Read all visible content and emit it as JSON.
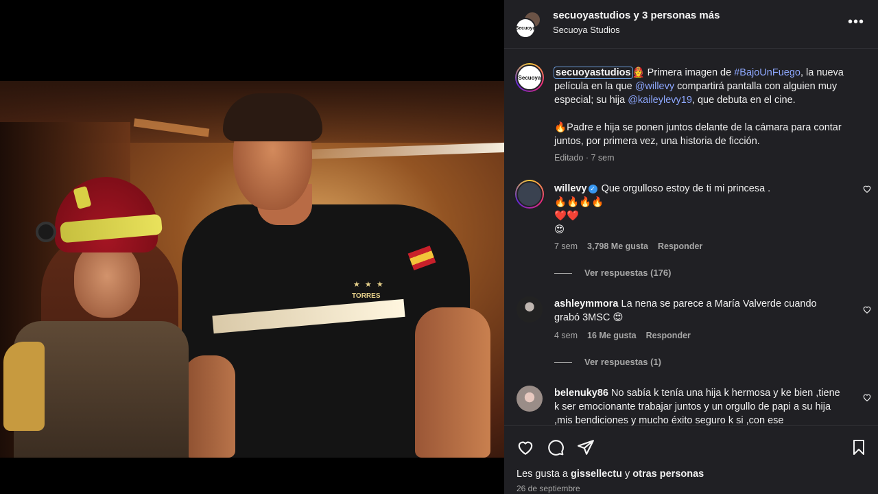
{
  "header": {
    "account": "secuoyastudios",
    "joined_text": " y 3 personas más",
    "subtitle": "Secuoya Studios",
    "avatar_text": "Secuoya",
    "more": "•••"
  },
  "photo": {
    "badge_name": "TORRES",
    "badge_stars": "★ ★ ★"
  },
  "caption": {
    "avatar_text": "Secuoya",
    "user": "secuoyastudios",
    "emoji1": "🧑‍🚒",
    "t1": " Primera imagen de ",
    "hashtag": "#BajoUnFuego",
    "t2": ", la nueva película en la que ",
    "mention1": "@willevy",
    "t3": " compartirá pantalla con alguien muy especial; su hija ",
    "mention2": "@kaileylevy19",
    "t4": ", que debuta en el cine.",
    "emoji2": "🔥",
    "t5": "Padre e hija se ponen juntos delante de la cámara para contar juntos, por primera vez, una historia de ficción.",
    "meta": "Editado · 7 sem"
  },
  "comments": [
    {
      "user": "willevy",
      "verified": true,
      "text": " Que orgulloso estoy de ti mi princesa .",
      "line2": "🔥🔥🔥🔥",
      "line3": "❤️❤️",
      "line4": "😍",
      "age": "7 sem",
      "likes": "3,798 Me gusta",
      "reply": "Responder",
      "replies": "Ver respuestas (176)"
    },
    {
      "user": "ashleymmora",
      "text": " La nena se parece a María Valverde cuando grabó 3MSC 😍",
      "age": "4 sem",
      "likes": "16 Me gusta",
      "reply": "Responder",
      "replies": "Ver respuestas (1)"
    },
    {
      "user": "belenuky86",
      "text": " No sabía k tenía una hija k hermosa y ke bien ,tiene k ser emocionante trabajar juntos y un orgullo de papi a su hija ,mis bendiciones y mucho éxito seguro k si ,con ese"
    }
  ],
  "footer": {
    "likes_prefix": "Les gusta a ",
    "likes_user": "gissellectu",
    "likes_mid": " y ",
    "likes_rest": "otras personas",
    "date": "26 de septiembre"
  },
  "colors": {
    "panel_bg": "#202024",
    "link": "#8ea8ff",
    "verified": "#3897f0"
  }
}
